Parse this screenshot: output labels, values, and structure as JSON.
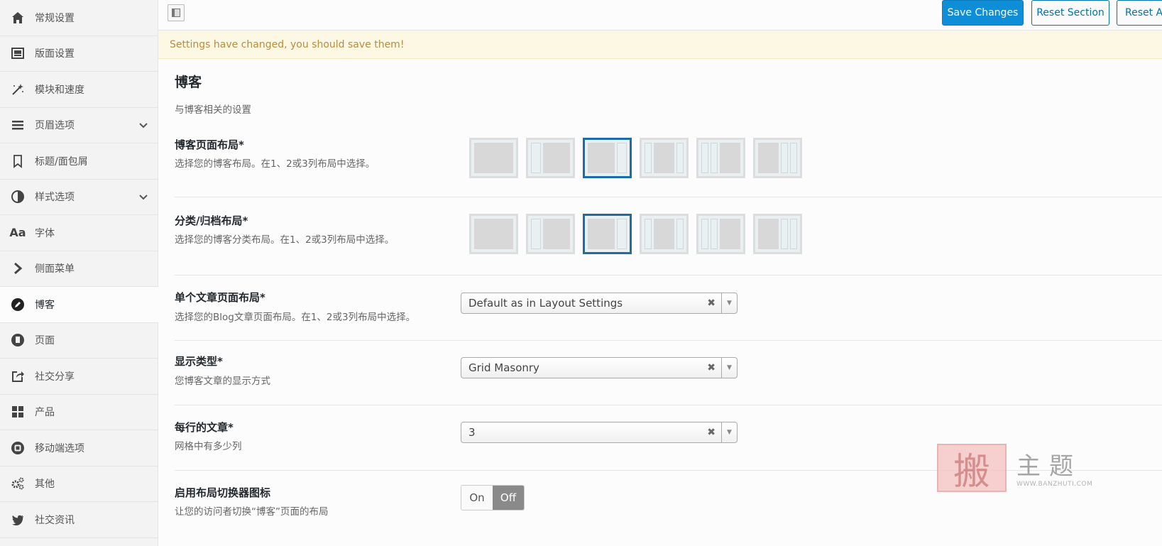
{
  "sidebar": {
    "items": [
      {
        "label": "常规设置",
        "icon": "home-icon"
      },
      {
        "label": "版面设置",
        "icon": "layout-icon"
      },
      {
        "label": "模块和速度",
        "icon": "magic-wand-icon"
      },
      {
        "label": "页眉选项",
        "icon": "menu-icon",
        "expandable": true
      },
      {
        "label": "标题/面包屑",
        "icon": "bookmark-icon"
      },
      {
        "label": "样式选项",
        "icon": "contrast-icon",
        "expandable": true
      },
      {
        "label": "字体",
        "icon": "font-icon"
      },
      {
        "label": "侧面菜单",
        "icon": "chevron-right-icon"
      },
      {
        "label": "博客",
        "icon": "edit-icon",
        "active": true
      },
      {
        "label": "页面",
        "icon": "page-icon"
      },
      {
        "label": "社交分享",
        "icon": "share-icon"
      },
      {
        "label": "产品",
        "icon": "grid-icon"
      },
      {
        "label": "移动端选项",
        "icon": "mobile-icon"
      },
      {
        "label": "其他",
        "icon": "cogs-icon"
      },
      {
        "label": "社交资讯",
        "icon": "twitter-icon"
      }
    ]
  },
  "toolbar": {
    "save_label": "Save Changes",
    "reset_section_label": "Reset Section",
    "reset_all_label": "Reset All"
  },
  "notice": "Settings have changed, you should save them!",
  "section": {
    "title": "博客",
    "description": "与博客相关的设置"
  },
  "fields": {
    "blog_layout": {
      "title": "博客页面布局*",
      "desc": "选择您的博客布局。在1、2或3列布局中选择。",
      "selected": 2
    },
    "archive_layout": {
      "title": "分类/归档布局*",
      "desc": "选择您的博客分类布局。在1、2或3列布局中选择。",
      "selected": 2
    },
    "single_layout": {
      "title": "单个文章页面布局*",
      "desc": "选择您的Blog文章页面布局。在1、2或3列布局中选择。",
      "value": "Default as in Layout Settings"
    },
    "display_type": {
      "title": "显示类型*",
      "desc": "您博客文章的显示方式",
      "value": "Grid Masonry"
    },
    "posts_per_row": {
      "title": "每行的文章*",
      "desc": "网格中有多少列",
      "value": "3"
    },
    "layout_switcher": {
      "title": "启用布局切换器图标",
      "desc": "让您的访问者切换“博客”页面的布局",
      "on_label": "On",
      "off_label": "Off",
      "state": "Off"
    }
  },
  "watermark": {
    "seal": "搬",
    "text": "主题",
    "url": "WWW.BANZHUTI.COM"
  },
  "colors": {
    "primary": "#0e8ed6",
    "link": "#0073aa",
    "selected_border": "#1a6ea8",
    "notice_bg": "#fcf8e3",
    "notice_text": "#b98c3e"
  }
}
